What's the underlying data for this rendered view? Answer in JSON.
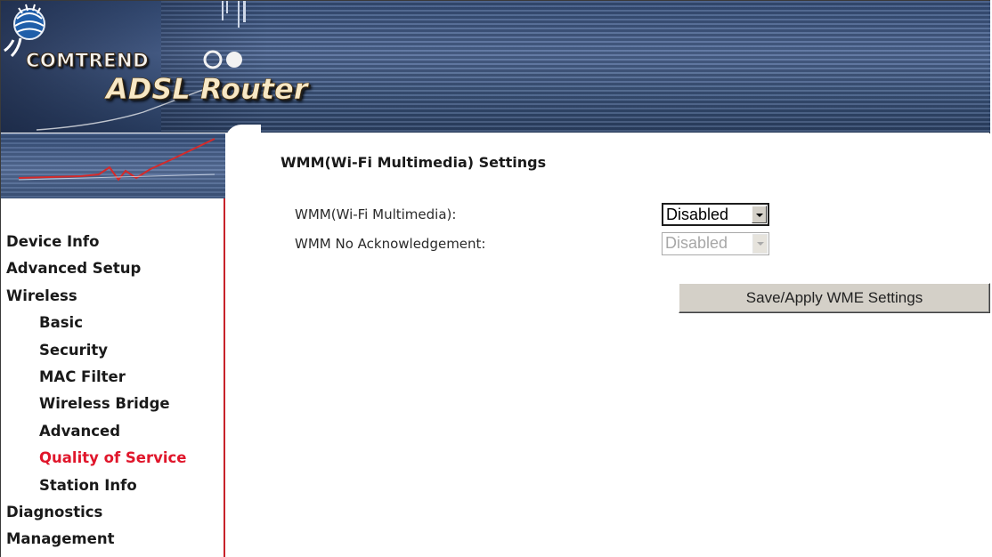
{
  "banner": {
    "brand": "COMTREND",
    "product": "ADSL Router"
  },
  "sidebar": {
    "items": [
      {
        "label": "Device Info"
      },
      {
        "label": "Advanced Setup"
      },
      {
        "label": "Wireless"
      },
      {
        "label": "Basic"
      },
      {
        "label": "Security"
      },
      {
        "label": "MAC Filter"
      },
      {
        "label": "Wireless Bridge"
      },
      {
        "label": "Advanced"
      },
      {
        "label": "Quality of Service"
      },
      {
        "label": "Station Info"
      },
      {
        "label": "Diagnostics"
      },
      {
        "label": "Management"
      }
    ],
    "active_item": "Quality of Service",
    "colors": {
      "active": "#e0162b",
      "border": "#c8222a"
    }
  },
  "main": {
    "title": "WMM(Wi-Fi Multimedia) Settings",
    "wmm": {
      "label": "WMM(Wi-Fi Multimedia):",
      "value": "Disabled"
    },
    "wmm_noack": {
      "label": "WMM No Acknowledgement:",
      "value": "Disabled",
      "disabled": true
    },
    "apply_button": "Save/Apply WME Settings"
  }
}
